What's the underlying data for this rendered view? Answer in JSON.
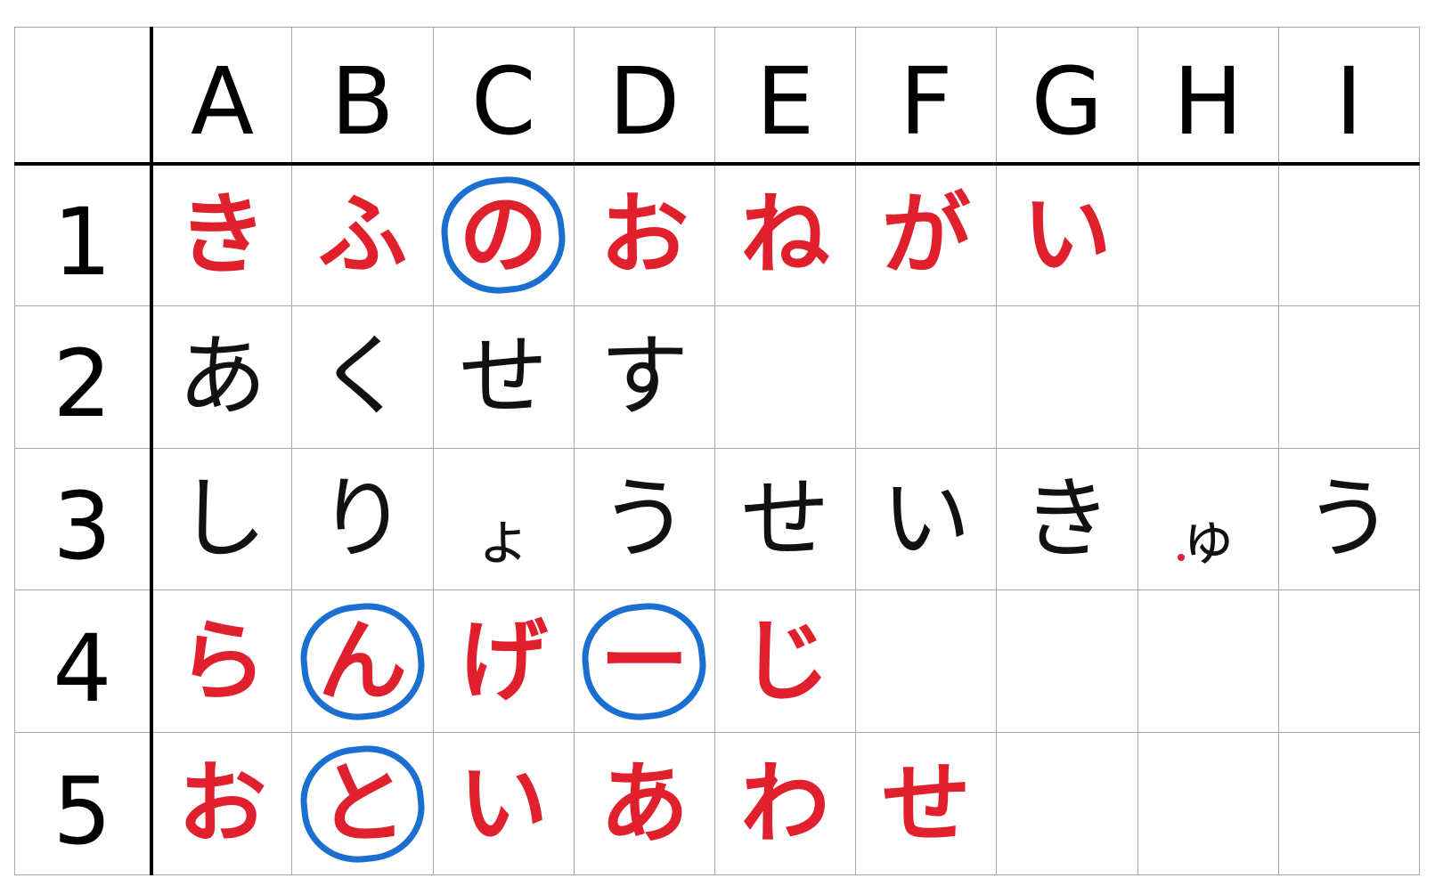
{
  "columns": [
    "A",
    "B",
    "C",
    "D",
    "E",
    "F",
    "G",
    "H",
    "I"
  ],
  "rows": [
    {
      "number": "1",
      "cells": [
        {
          "text": "き",
          "color": "red",
          "circled": false
        },
        {
          "text": "ふ",
          "color": "red",
          "circled": false
        },
        {
          "text": "の",
          "color": "red",
          "circled": true
        },
        {
          "text": "お",
          "color": "red",
          "circled": false
        },
        {
          "text": "ね",
          "color": "red",
          "circled": false
        },
        {
          "text": "が",
          "color": "red",
          "circled": false
        },
        {
          "text": "い",
          "color": "red",
          "circled": false
        },
        {
          "text": "",
          "color": "red",
          "circled": false
        },
        {
          "text": "",
          "color": "red",
          "circled": false
        }
      ]
    },
    {
      "number": "2",
      "cells": [
        {
          "text": "あ",
          "color": "black",
          "circled": false
        },
        {
          "text": "く",
          "color": "black",
          "circled": false
        },
        {
          "text": "せ",
          "color": "black",
          "circled": false
        },
        {
          "text": "す",
          "color": "black",
          "circled": false
        },
        {
          "text": "",
          "color": "black",
          "circled": false
        },
        {
          "text": "",
          "color": "black",
          "circled": false
        },
        {
          "text": "",
          "color": "black",
          "circled": false
        },
        {
          "text": "",
          "color": "black",
          "circled": false
        },
        {
          "text": "",
          "color": "black",
          "circled": false
        }
      ]
    },
    {
      "number": "3",
      "cells": [
        {
          "text": "し",
          "color": "black",
          "circled": false
        },
        {
          "text": "り",
          "color": "black",
          "circled": false
        },
        {
          "text": "ょ",
          "color": "black",
          "circled": false,
          "small": true
        },
        {
          "text": "う",
          "color": "black",
          "circled": false
        },
        {
          "text": "せ",
          "color": "black",
          "circled": false
        },
        {
          "text": "い",
          "color": "black",
          "circled": false
        },
        {
          "text": "き",
          "color": "black",
          "circled": false
        },
        {
          "text": "ゅ",
          "color": "black",
          "circled": false,
          "small": true,
          "red_dot": true
        },
        {
          "text": "う",
          "color": "black",
          "circled": false
        }
      ]
    },
    {
      "number": "4",
      "cells": [
        {
          "text": "ら",
          "color": "red",
          "circled": false
        },
        {
          "text": "ん",
          "color": "red",
          "circled": true
        },
        {
          "text": "げ",
          "color": "red",
          "circled": false
        },
        {
          "text": "ー",
          "color": "red",
          "circled": true
        },
        {
          "text": "じ",
          "color": "red",
          "circled": false
        },
        {
          "text": "",
          "color": "red",
          "circled": false
        },
        {
          "text": "",
          "color": "red",
          "circled": false
        },
        {
          "text": "",
          "color": "red",
          "circled": false
        },
        {
          "text": "",
          "color": "red",
          "circled": false
        }
      ]
    },
    {
      "number": "5",
      "cells": [
        {
          "text": "お",
          "color": "red",
          "circled": false
        },
        {
          "text": "と",
          "color": "red",
          "circled": true
        },
        {
          "text": "い",
          "color": "red",
          "circled": false
        },
        {
          "text": "あ",
          "color": "red",
          "circled": false
        },
        {
          "text": "わ",
          "color": "red",
          "circled": false
        },
        {
          "text": "せ",
          "color": "red",
          "circled": false
        },
        {
          "text": "",
          "color": "red",
          "circled": false
        },
        {
          "text": "",
          "color": "red",
          "circled": false
        },
        {
          "text": "",
          "color": "red",
          "circled": false
        }
      ]
    }
  ],
  "colors": {
    "red_ink": "#e0202c",
    "black_ink": "#111111",
    "circle_ink": "#1a6fd0",
    "grid_line": "#a8a8a8",
    "heavy_rule": "#000000"
  }
}
